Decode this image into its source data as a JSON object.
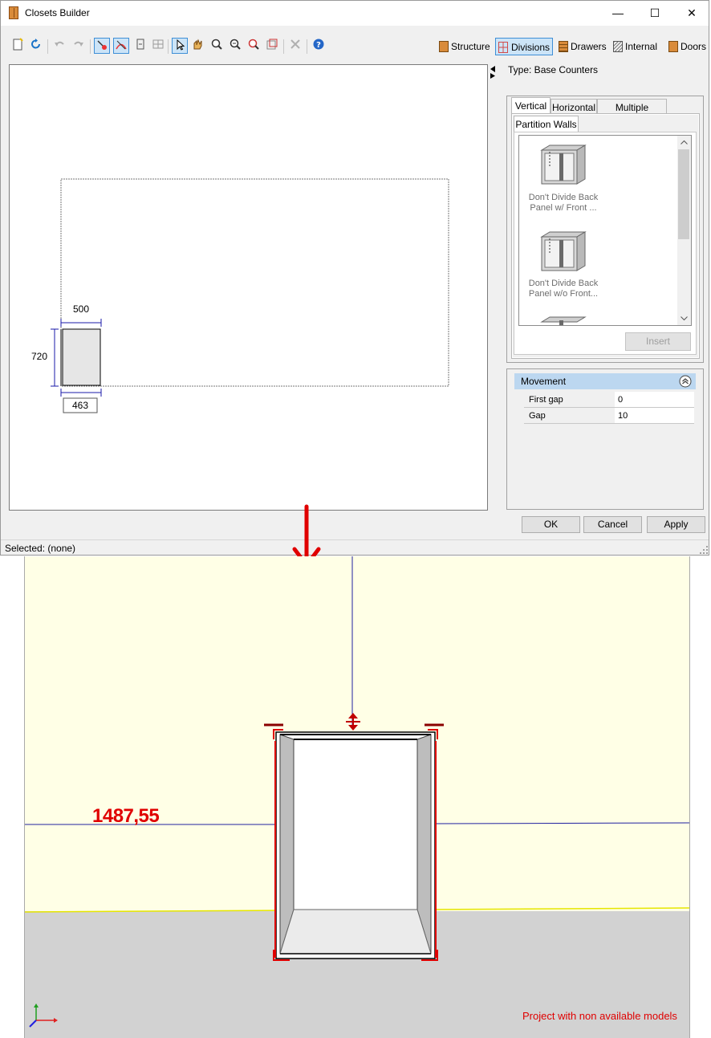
{
  "window": {
    "title": "Closets Builder",
    "minimize": "—",
    "maximize": "☐",
    "close": "✕"
  },
  "toolbar_tabs": [
    {
      "label": "Structure",
      "color": "#d98b3a"
    },
    {
      "label": "Divisions",
      "color": "#d24a4a"
    },
    {
      "label": "Drawers",
      "color": "#d98b3a"
    },
    {
      "label": "Internal",
      "color": "#6a6a6a"
    },
    {
      "label": "Doors",
      "color": "#d98b3a"
    }
  ],
  "toolbar_icons": [
    "new-icon",
    "refresh-icon",
    "undo-icon",
    "redo-icon",
    "select-node-icon",
    "select-edge-icon",
    "resize-icon",
    "grid-icon",
    "pointer-icon",
    "pan-icon",
    "zoom-in-icon",
    "zoom-out-icon",
    "zoom-window-icon",
    "zoom-extents-icon",
    "delete-icon",
    "help-icon"
  ],
  "canvas": {
    "dim_width": "500",
    "dim_height": "720",
    "dim_depth": "463"
  },
  "panel": {
    "type_label": "Type: Base Counters",
    "tabs": [
      "Vertical",
      "Horizontal",
      "Multiple insertion"
    ],
    "selected_tab": "Vertical",
    "subtab": "Partition Walls",
    "items": [
      {
        "label_line1": "Don't Divide Back",
        "label_line2": "Panel w/ Front ..."
      },
      {
        "label_line1": "Don't Divide Back",
        "label_line2": "Panel w/o Front..."
      }
    ],
    "insert_label": "Insert"
  },
  "properties": {
    "group": "Movement",
    "rows": [
      {
        "label": "First gap",
        "value": "0"
      },
      {
        "label": "Gap",
        "value": "10"
      }
    ]
  },
  "buttons": {
    "ok": "OK",
    "cancel": "Cancel",
    "apply": "Apply"
  },
  "status": "Selected: (none)",
  "viewport": {
    "measure": "1487,55",
    "warning": "Project with non available models",
    "wall_color": "#ffffe6",
    "floor_color": "#d2d2d2",
    "highlight_color": "#e00000"
  }
}
